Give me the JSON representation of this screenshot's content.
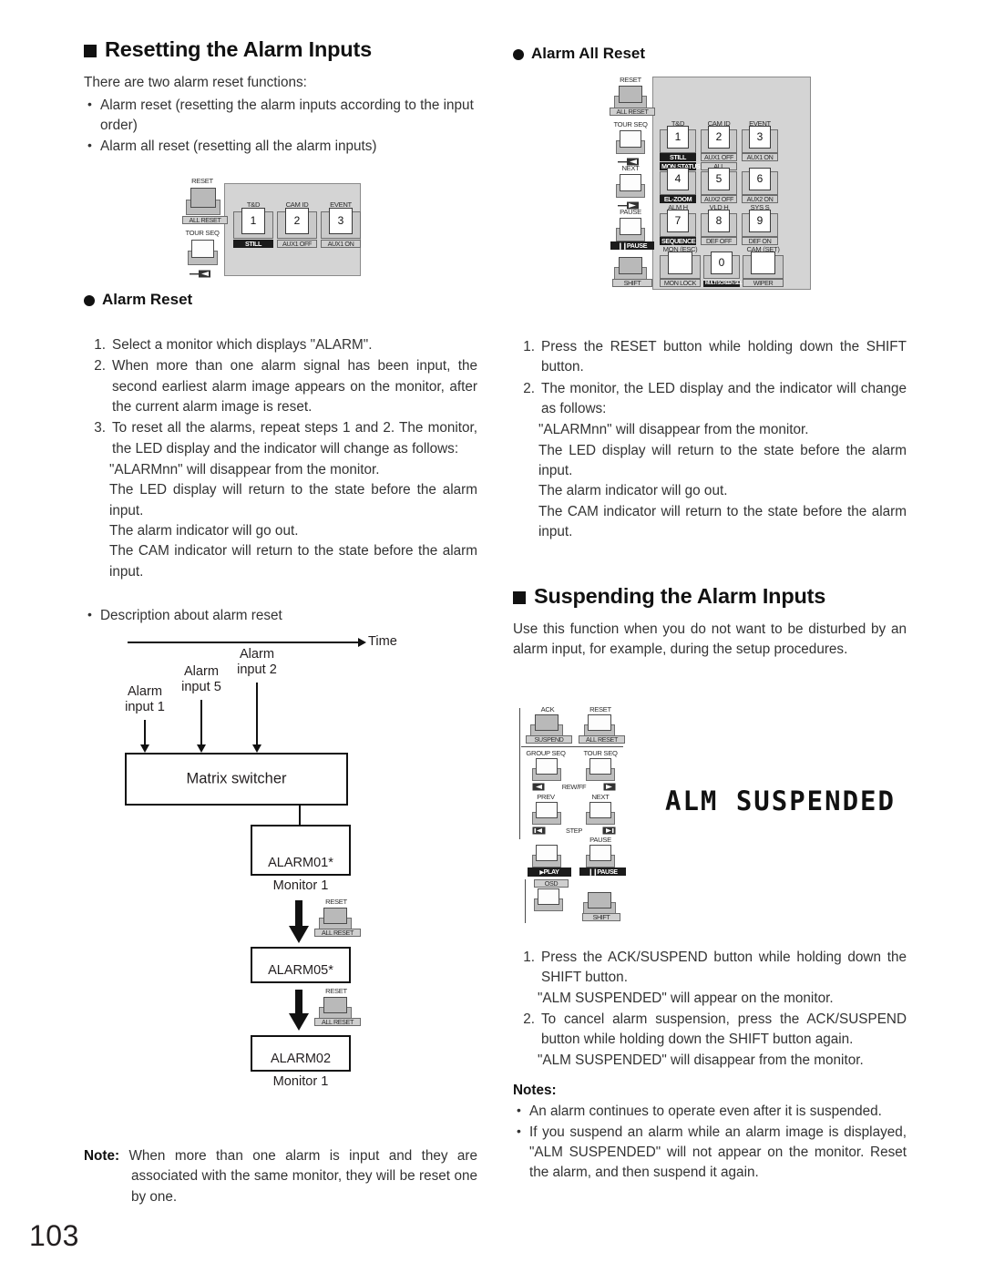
{
  "page": {
    "number": "103"
  },
  "left": {
    "heading": "Resetting the Alarm Inputs",
    "intro": "There are two alarm reset functions:",
    "bullets": [
      "Alarm reset (resetting the alarm inputs according to the input order)",
      "Alarm all reset (resetting all the alarm inputs)"
    ],
    "alarm_reset": {
      "heading": "Alarm Reset",
      "steps": [
        "Select a monitor which displays \"ALARM\".",
        "When more than one alarm signal has been input, the second earliest alarm image appears on the monitor, after the current alarm image is reset.",
        "To reset all the alarms, repeat steps 1 and 2. The monitor, the LED display and the indicator will change as follows:"
      ],
      "sub_results": [
        "\"ALARMnn\" will disappear from the monitor.",
        "The LED display will return to the state before the alarm input.",
        "The alarm indicator will go out.",
        "The CAM indicator will return to the state before the alarm input."
      ]
    },
    "diagram": {
      "caption": "Description about alarm reset",
      "time_label": "Time",
      "inputs": [
        {
          "line1": "Alarm",
          "line2": "input 1"
        },
        {
          "line1": "Alarm",
          "line2": "input 5"
        },
        {
          "line1": "Alarm",
          "line2": "input 2"
        }
      ],
      "switcher_label": "Matrix switcher",
      "monitor_states": [
        {
          "alarm": "ALARM01*",
          "monitor": "Monitor 1"
        },
        {
          "alarm": "ALARM05*",
          "monitor": ""
        },
        {
          "alarm": "ALARM02",
          "monitor": "Monitor 1"
        }
      ],
      "reset_key": {
        "top_label": "RESET",
        "cap_label": "ALL RESET"
      }
    },
    "note": {
      "label": "Note:",
      "text": "When more than one alarm is input and they are associated with the same monitor, they will be reset one by one."
    }
  },
  "right": {
    "alarm_all_reset": {
      "heading": "Alarm All Reset",
      "steps": [
        "Press the RESET button while holding down the SHIFT button.",
        "The monitor, the LED display and the indicator will change as follows:"
      ],
      "sub_results": [
        "\"ALARMnn\" will disappear from the monitor.",
        "The LED display will return to the state before the alarm input.",
        "The alarm indicator will go out.",
        "The CAM indicator will return to the state before the alarm input."
      ]
    },
    "suspending": {
      "heading": "Suspending the Alarm Inputs",
      "intro": "Use this function when you do not want to be disturbed by an alarm input, for example, during the setup procedures.",
      "monitor_text": "ALM SUSPENDED",
      "steps": [
        "Press the ACK/SUSPEND button while holding down the SHIFT button.",
        "To cancel alarm suspension, press the ACK/SUSPEND button while holding down the SHIFT button again."
      ],
      "step_results": [
        "\"ALM SUSPENDED\" will appear on the monitor.",
        "\"ALM SUSPENDED\" will disappear from the monitor."
      ],
      "notes_title": "Notes:",
      "notes": [
        "An alarm continues to operate even after it is suspended.",
        "If you suspend an alarm while an alarm image is displayed, \"ALM SUSPENDED\" will not appear on the monitor. Reset the alarm, and then suspend it again."
      ]
    }
  },
  "panels": {
    "small_left": {
      "keys": [
        {
          "top": "RESET",
          "cap": "ALL RESET",
          "inverted": false
        },
        {
          "top": "TOUR SEQ",
          "cap": "",
          "inverted": false
        }
      ],
      "numkeys": [
        {
          "top": "T&D",
          "num": "1",
          "bottom": "STILL",
          "inverted": true
        },
        {
          "top": "CAM ID",
          "num": "2",
          "bottom": "AUX1 OFF",
          "inverted": false
        },
        {
          "top": "EVENT",
          "num": "3",
          "bottom": "AUX1 ON",
          "inverted": false
        }
      ]
    },
    "keypad": {
      "left_keys": [
        {
          "top": "RESET",
          "cap": "ALL RESET"
        },
        {
          "top": "TOUR SEQ",
          "cap": ""
        },
        {
          "top": "NEXT",
          "cap": ""
        },
        {
          "top": "PAUSE",
          "cap": "PAUSE"
        },
        {
          "top": "",
          "cap": "SHIFT"
        }
      ],
      "numkeys": [
        {
          "top": "T&D",
          "num": "1",
          "bottom": "STILL",
          "top_inv": false,
          "bot_inv": true
        },
        {
          "top": "CAM ID",
          "num": "2",
          "bottom": "AUX1 OFF",
          "top_inv": false,
          "bot_inv": false
        },
        {
          "top": "EVENT",
          "num": "3",
          "bottom": "AUX1 ON",
          "top_inv": false,
          "bot_inv": false
        },
        {
          "top": "MON STATUS",
          "num": "4",
          "bottom": "EL-ZOOM",
          "top_inv": true,
          "bot_inv": true
        },
        {
          "top": "ALL",
          "num": "5",
          "bottom": "AUX2 OFF",
          "top_inv": false,
          "bot_inv": false
        },
        {
          "top": "",
          "num": "6",
          "bottom": "AUX2 ON",
          "top_inv": false,
          "bot_inv": false
        },
        {
          "top": "ALM H",
          "num": "7",
          "bottom": "SEQUENCE",
          "top_inv": false,
          "bot_inv": true
        },
        {
          "top": "VLD H",
          "num": "8",
          "bottom": "DEF OFF",
          "top_inv": false,
          "bot_inv": false
        },
        {
          "top": "SYS S",
          "num": "9",
          "bottom": "DEF ON",
          "top_inv": false,
          "bot_inv": false
        },
        {
          "top": "MON (ESC)",
          "num": "",
          "bottom": "MON LOCK",
          "top_inv": false,
          "bot_inv": false
        },
        {
          "top": "",
          "num": "0",
          "bottom": "MULTI SCREEN SEL",
          "top_inv": false,
          "bot_inv": true
        },
        {
          "top": "CAM (SET)",
          "num": "",
          "bottom": "WIPER",
          "top_inv": false,
          "bot_inv": false
        }
      ]
    },
    "suspend_panel": {
      "rows": [
        {
          "left_top": "ACK",
          "left_cap": "SUSPEND",
          "right_top": "RESET",
          "right_cap": "ALL RESET"
        },
        {
          "left_top": "GROUP SEQ",
          "left_cap": "",
          "right_top": "TOUR SEQ",
          "right_cap": "",
          "mid": "REW/FF"
        },
        {
          "left_top": "PREV",
          "left_cap": "",
          "right_top": "NEXT",
          "right_cap": "",
          "mid": "STEP"
        },
        {
          "left_top": "",
          "left_cap": "PLAY",
          "right_top": "PAUSE",
          "right_cap": "PAUSE"
        },
        {
          "left_top": "OSD",
          "left_cap": "",
          "right_top": "",
          "right_cap": "SHIFT"
        }
      ]
    }
  }
}
